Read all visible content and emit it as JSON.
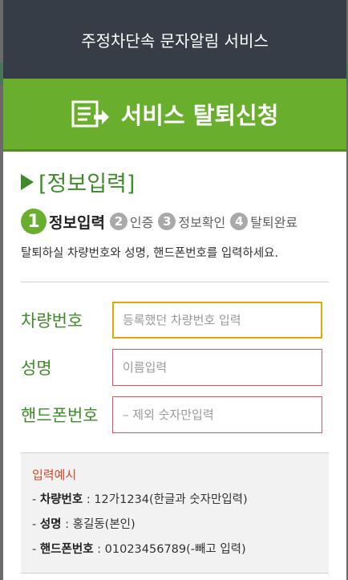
{
  "header": {
    "title": "주정차단속 문자알림 서비스"
  },
  "banner": {
    "title": "서비스 탈퇴신청",
    "icon": "document-arrow-icon"
  },
  "section": {
    "title": "[정보입력]"
  },
  "steps": [
    {
      "num": "1",
      "label": "정보입력",
      "active": true
    },
    {
      "num": "2",
      "label": "인증",
      "active": false
    },
    {
      "num": "3",
      "label": "정보확인",
      "active": false
    },
    {
      "num": "4",
      "label": "탈퇴완료",
      "active": false
    }
  ],
  "instruction": "탈퇴하실 차량번호와 성명, 핸드폰번호를 입력하세요.",
  "form": {
    "vehicle": {
      "label": "차량번호",
      "placeholder": "등록했던 차량번호 입력",
      "value": ""
    },
    "name": {
      "label": "성명",
      "placeholder": "이름입력",
      "value": ""
    },
    "phone": {
      "label": "핸드폰번호",
      "placeholder": "– 제외 숫자만입력",
      "value": ""
    }
  },
  "example": {
    "title": "입력예시",
    "lines": [
      {
        "prefix": "- ",
        "key": "차량번호",
        "sep": " : ",
        "value": "12가1234(한글과 숫자만입력)"
      },
      {
        "prefix": "- ",
        "key": "성명",
        "sep": " : ",
        "value": "홍길동(본인)"
      },
      {
        "prefix": "- ",
        "key": "핸드폰번호",
        "sep": " : ",
        "value": "01023456789(-빼고 입력)"
      }
    ]
  },
  "colors": {
    "header_bg": "#363d47",
    "banner_bg": "#6aae2e",
    "label_green": "#3f8b2c",
    "error_red": "#e0555a",
    "focus_amber": "#e0a800",
    "example_red": "#d9452b"
  }
}
